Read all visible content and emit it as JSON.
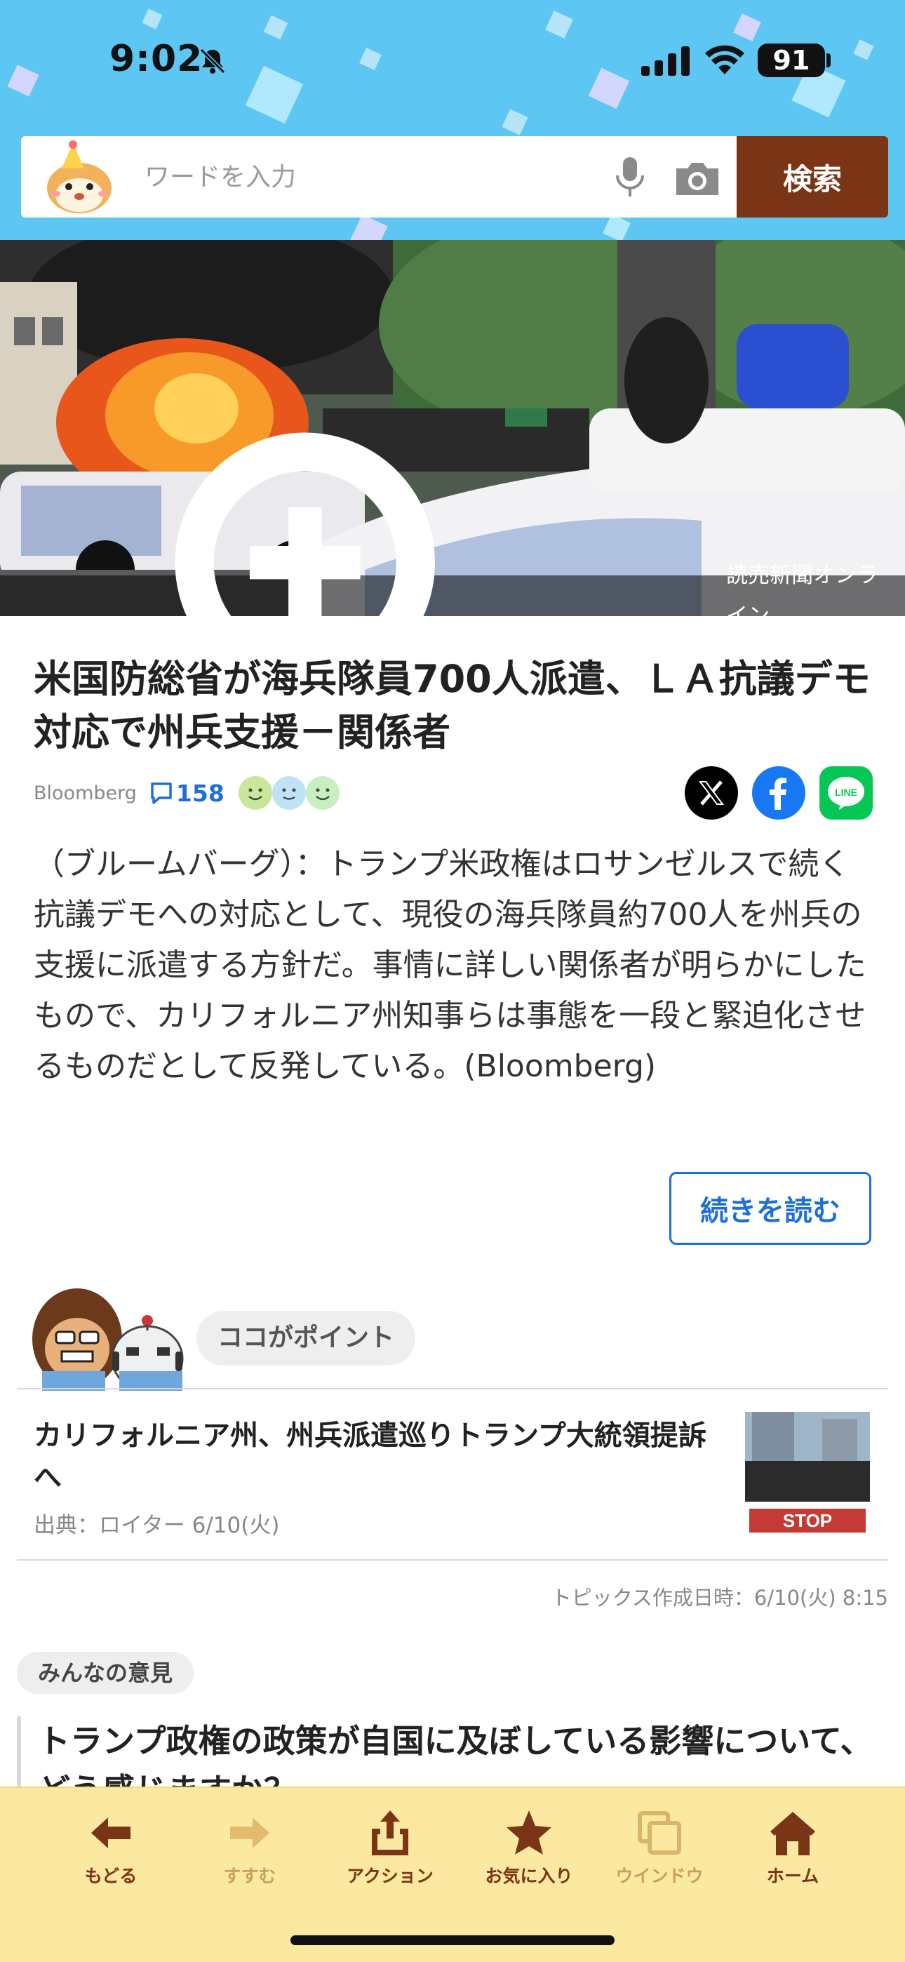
{
  "status_bar": {
    "time": "9:02",
    "battery": "91"
  },
  "search": {
    "placeholder": "ワードを入力",
    "button_label": "検索"
  },
  "hero": {
    "credit": "読売新聞オンライン"
  },
  "article": {
    "headline": "米国防総省が海兵隊員700人派遣、ＬＡ抗議デモ対応で州兵支援－関係者",
    "source": "Bloomberg",
    "comment_count": "158",
    "summary": "（ブルームバーグ）：トランプ米政権はロサンゼルスで続く抗議デモへの対応として、現役の海兵隊員約700人を州兵の支援に派遣する方針だ。事情に詳しい関係者が明らかにしたもので、カリフォルニア州知事らは事態を一段と緊迫化させるものだとして反発している。(Bloomberg)",
    "read_more": "続きを読む"
  },
  "point": {
    "label": "ココがポイント",
    "title": "カリフォルニア州、州兵派遣巡りトランプ大統領提訴へ",
    "source": "出典：ロイター 6/10(火)",
    "topic_date": "トピックス作成日時：6/10(火) 8:15"
  },
  "opinion": {
    "label": "みんなの意見",
    "question": "トランプ政権の政策が自国に及ぼしている影響について、どう感じますか？"
  },
  "toolbar": {
    "back": "もどる",
    "forward": "すすむ",
    "action": "アクション",
    "favorite": "お気に入り",
    "window": "ウインドウ",
    "home": "ホーム"
  },
  "colors": {
    "header_bg": "#5ec6f2",
    "search_button": "#7a3516",
    "link_blue": "#1f6fd8",
    "toolbar_bg": "#fbe9a2"
  }
}
